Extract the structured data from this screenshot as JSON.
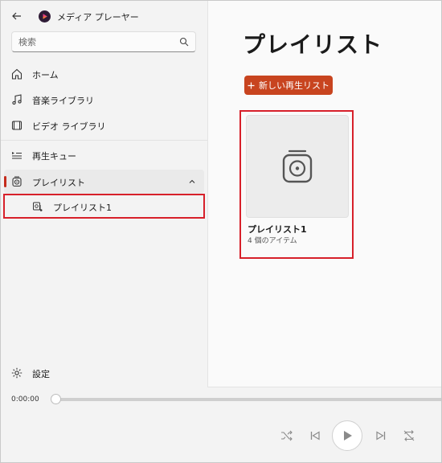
{
  "app": {
    "title": "メディア プレーヤー"
  },
  "search": {
    "placeholder": "検索"
  },
  "nav": {
    "home": "ホーム",
    "music": "音楽ライブラリ",
    "video": "ビデオ ライブラリ",
    "queue": "再生キュー",
    "playlists": "プレイリスト",
    "playlist1": "プレイリスト1",
    "settings": "設定"
  },
  "main": {
    "title": "プレイリスト",
    "new_playlist_label": "新しい再生リスト",
    "cards": [
      {
        "title": "プレイリスト1",
        "subtitle": "4 個のアイテム"
      }
    ]
  },
  "player": {
    "time": "0:00:00",
    "progress": 0
  },
  "colors": {
    "accent": "#c8441f",
    "highlight_box": "#d7202a",
    "selection_bar": "#c42b1c"
  },
  "icons": [
    "back-icon",
    "app-logo-icon",
    "search-icon",
    "home-icon",
    "music-note-icon",
    "film-icon",
    "queue-icon",
    "playlist-icon",
    "chevron-up-icon",
    "playlist-item-icon",
    "gear-icon",
    "plus-icon",
    "shuffle-icon",
    "previous-icon",
    "play-icon",
    "next-icon",
    "repeat-icon"
  ]
}
